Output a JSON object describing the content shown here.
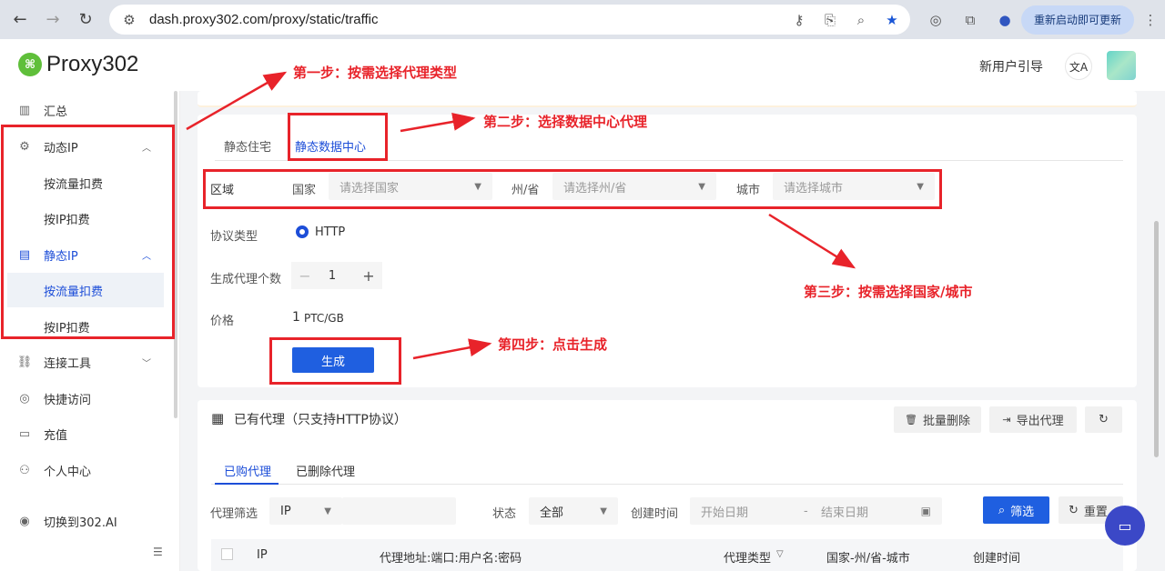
{
  "browser": {
    "url": "dash.proxy302.com/proxy/static/traffic",
    "update_label": "重新启动即可更新"
  },
  "header": {
    "brand": "Proxy302",
    "guide": "新用户引导",
    "translate_glyph": "文A"
  },
  "sidebar": {
    "items": [
      {
        "label": "汇总",
        "icon": "bar-chart-icon"
      },
      {
        "label": "动态IP",
        "icon": "gear-icon"
      },
      {
        "label": "按流量扣费"
      },
      {
        "label": "按IP扣费"
      },
      {
        "label": "静态IP",
        "icon": "server-icon"
      },
      {
        "label": "按流量扣费"
      },
      {
        "label": "按IP扣费"
      },
      {
        "label": "连接工具",
        "icon": "link-icon"
      },
      {
        "label": "快捷访问",
        "icon": "chrome-icon"
      },
      {
        "label": "充值",
        "icon": "card-icon"
      },
      {
        "label": "个人中心",
        "icon": "user-icon"
      },
      {
        "label": "切换到302.AI",
        "icon": "switch-icon"
      }
    ]
  },
  "proxy_tabs": [
    "静态住宅",
    "静态数据中心"
  ],
  "form": {
    "region_label": "区域",
    "country_label": "国家",
    "country_placeholder": "请选择国家",
    "state_label": "州/省",
    "state_placeholder": "请选择州/省",
    "city_label": "城市",
    "city_placeholder": "请选择城市",
    "protocol_label": "协议类型",
    "protocol_value": "HTTP",
    "count_label": "生成代理个数",
    "count_value": "1",
    "price_label": "价格",
    "price_value": "1",
    "price_unit": "PTC/GB",
    "generate_label": "生成"
  },
  "annotations": {
    "step1": "第一步：按需选择代理类型",
    "step2": "第二步：选择数据中心代理",
    "step3": "第三步：按需选择国家/城市",
    "step4": "第四步：点击生成"
  },
  "existing": {
    "title": "已有代理（只支持HTTP协议）",
    "batch_delete": "批量删除",
    "export": "导出代理",
    "tabs": [
      "已购代理",
      "已删除代理"
    ],
    "filter_label": "代理筛选",
    "filter_value": "IP",
    "status_label": "状态",
    "status_value": "全部",
    "created_label": "创建时间",
    "start_date": "开始日期",
    "end_date": "结束日期",
    "date_sep": "-",
    "filter_btn": "筛选",
    "reset_btn": "重置",
    "columns": [
      "IP",
      "代理地址:端口:用户名:密码",
      "代理类型",
      "国家-州/省-城市",
      "创建时间"
    ]
  },
  "colors": {
    "accent": "#1f5fe0",
    "annotation": "#e8232a",
    "chat": "#3b48c7"
  }
}
